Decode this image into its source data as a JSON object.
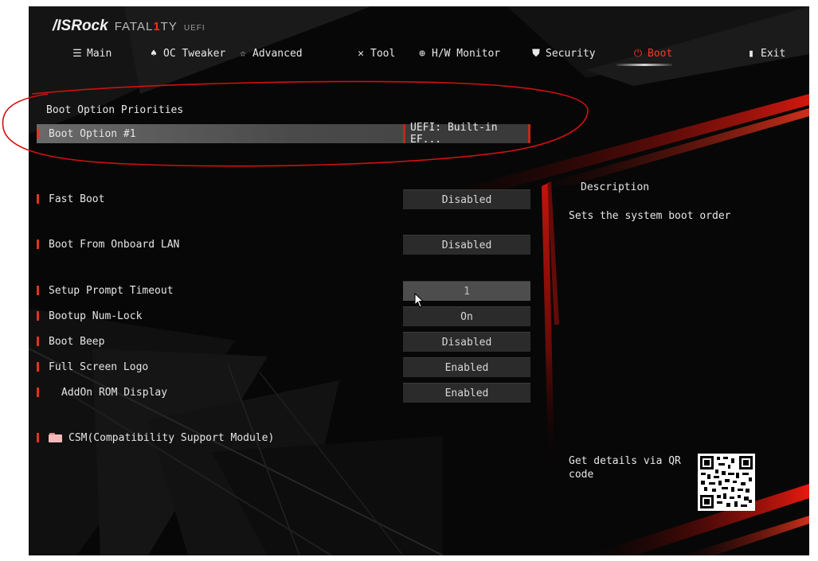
{
  "header": {
    "brand": "/ISRock",
    "product_prefix": "FATAL",
    "product_one": "1",
    "product_suffix": "TY",
    "product_sub": "UEFI"
  },
  "nav": {
    "tabs": [
      {
        "label": "Main",
        "icon": "list-icon"
      },
      {
        "label": "OC Tweaker",
        "icon": "rocket-icon"
      },
      {
        "label": "Advanced",
        "icon": "star-icon"
      },
      {
        "label": "Tool",
        "icon": "tools-icon"
      },
      {
        "label": "H/W Monitor",
        "icon": "globe-icon"
      },
      {
        "label": "Security",
        "icon": "shield-icon"
      },
      {
        "label": "Boot",
        "icon": "power-icon",
        "active": true
      },
      {
        "label": "Exit",
        "icon": "exit-door-icon"
      }
    ]
  },
  "boot": {
    "section_title": "Boot Option Priorities",
    "boot_option_1": {
      "label": "Boot Option #1",
      "value": "UEFI: Built-in EF..."
    },
    "fast_boot": {
      "label": "Fast Boot",
      "value": "Disabled"
    },
    "boot_from_lan": {
      "label": "Boot From Onboard LAN",
      "value": "Disabled"
    },
    "setup_prompt_timeout": {
      "label": "Setup Prompt Timeout",
      "value": "1"
    },
    "bootup_numlock": {
      "label": "Bootup Num-Lock",
      "value": "On"
    },
    "boot_beep": {
      "label": "Boot Beep",
      "value": "Disabled"
    },
    "full_screen_logo": {
      "label": "Full Screen Logo",
      "value": "Enabled"
    },
    "addon_rom_display": {
      "label": "AddOn ROM Display",
      "value": "Enabled"
    },
    "csm": {
      "label": "CSM(Compatibility Support Module)"
    }
  },
  "description": {
    "title": "Description",
    "text": "Sets the system boot order",
    "qr_text": "Get details via QR code"
  },
  "colors": {
    "accent": "#e0351f",
    "active_tab": "#ff3322",
    "annotation": "#d01010"
  }
}
